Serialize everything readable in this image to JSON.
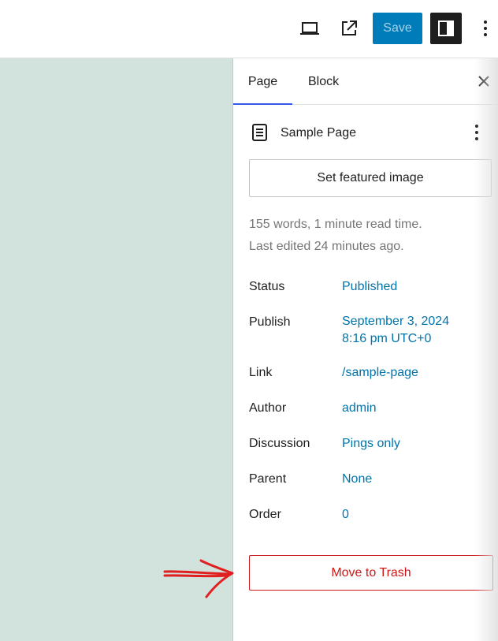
{
  "toolbar": {
    "save_label": "Save",
    "icons": [
      "laptop-icon",
      "external-link-icon",
      "sidebar-toggle-icon",
      "more-vertical-icon"
    ],
    "save_color": "#007cba"
  },
  "sidebar": {
    "tabs": [
      {
        "label": "Page",
        "active": true
      },
      {
        "label": "Block",
        "active": false
      }
    ],
    "page_title": "Sample Page",
    "featured_image_label": "Set featured image",
    "stats_line": "155 words, 1 minute read time.",
    "edited_line": "Last edited 24 minutes ago.",
    "properties": [
      {
        "label": "Status",
        "value": "Published"
      },
      {
        "label": "Publish",
        "value": "September 3, 2024",
        "value2": "8:16 pm UTC+0"
      },
      {
        "label": "Link",
        "value": "/sample-page"
      },
      {
        "label": "Author",
        "value": "admin"
      },
      {
        "label": "Discussion",
        "value": "Pings only"
      },
      {
        "label": "Parent",
        "value": "None"
      },
      {
        "label": "Order",
        "value": "0"
      }
    ],
    "trash_label": "Move to Trash"
  },
  "colors": {
    "canvas_bg": "#d2e3de",
    "link": "#0073aa",
    "danger": "#cc1818",
    "annotation_arrow": "#e02020"
  }
}
